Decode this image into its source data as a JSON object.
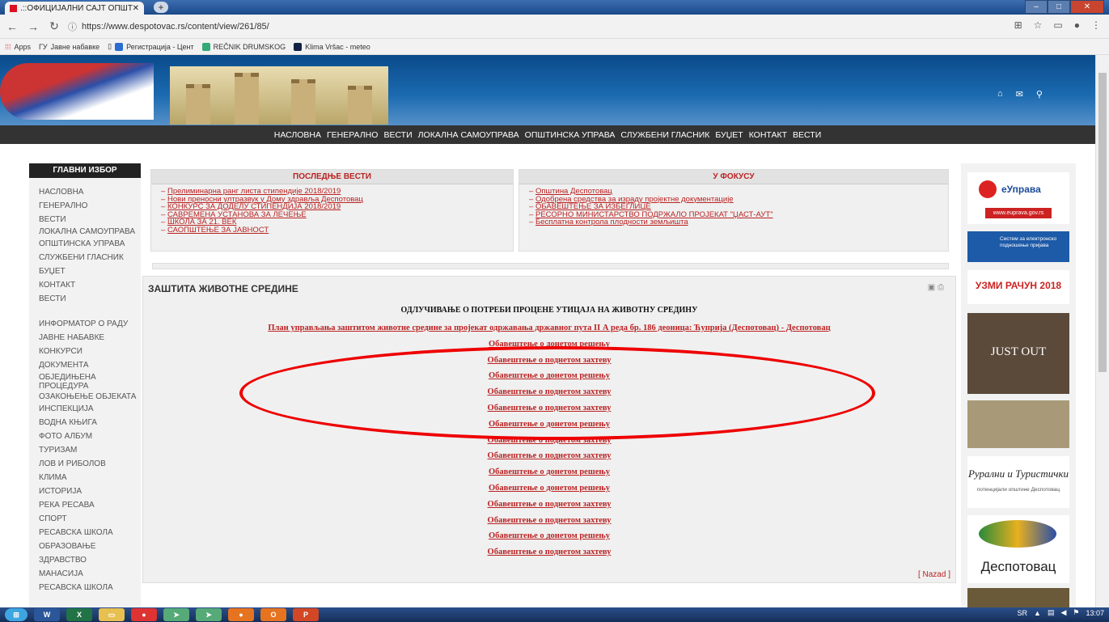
{
  "browser": {
    "tab_title": ".::ОФИЦИЈАЛНИ САЈТ ОПШТИ",
    "url": "https://www.despotovac.rs/content/view/261/85/",
    "bookmarks": [
      "Apps",
      "Јавне набавке",
      "Регистрација - Цент",
      "REČNIK DRUMSKOG",
      "Klima Vršac - meteo"
    ]
  },
  "nav": [
    "НАСЛОВНА",
    "ГЕНЕРАЛНО",
    "ВЕСТИ",
    "ЛОКАЛНА САМОУПРАВА",
    "ОПШТИНСКА УПРАВА",
    "СЛУЖБЕНИ ГЛАСНИК",
    "БУЏЕТ",
    "КОНТАКТ",
    "ВЕСТИ"
  ],
  "left_menu": {
    "title": "ГЛАВНИ ИЗБОР",
    "items": [
      "НАСЛОВНА",
      "ГЕНЕРАЛНО",
      "ВЕСТИ",
      "ЛОКАЛНА САМОУПРАВА",
      "ОПШТИНСКА УПРАВА",
      "СЛУЖБЕНИ ГЛАСНИК",
      "БУЏЕТ",
      "КОНТАКТ",
      "ВЕСТИ",
      "",
      "ИНФОРМАТОР О РАДУ",
      "ЈАВНЕ НАБАВКЕ",
      "КОНКУРСИ",
      "ДОКУМЕНТА",
      "ОБЈЕДИЊЕНА ПРОЦЕДУРА",
      "ОЗАКОЊЕЊЕ ОБЈЕКАТА",
      "ИНСПЕКЦИЈА",
      "ВОДНА КЊИГА",
      "ФОТО АЛБУМ",
      "ТУРИЗАМ",
      "ЛОВ И РИБОЛОВ",
      "КЛИМА",
      "ИСТОРИЈА",
      "РЕКА РЕСАВА",
      "СПОРТ",
      "РЕСАВСКА ШКОЛА",
      "ОБРАЗОВАЊЕ",
      "ЗДРАВСТВО",
      "МАНАСИЈА",
      "РЕСАВСКА ШКОЛА"
    ]
  },
  "latest_news": {
    "title": "ПОСЛЕДЊЕ ВЕСТИ",
    "items": [
      "Прелиминарна ранг листа стипендије 2018/2019",
      "Нови преносни ултразвук у Дому здравља Деспотовац",
      "КОНКУРС ЗА ДОДЕЛУ СТИПЕНДИЈА 2018/2019",
      "САВРЕМЕНА УСТАНОВА ЗА ЛЕЧЕЊЕ",
      "ШКОЛА ЗА 21. ВЕК",
      "САОПШТЕЊЕ ЗА ЈАВНОСТ"
    ]
  },
  "focus": {
    "title": "У ФОКУСУ",
    "items": [
      "Општина Деспотовац",
      "Одобрена средства за израду пројектне документације",
      "ОБАВЕШТЕЊЕ ЗА ИЗБЕГЛИЦЕ",
      "РЕСОРНО МИНИСТАРСТВО ПОДРЖАЛО ПРОЈЕКАТ \"ЏАСТ-АУТ\"",
      "Бесплатна контрола плодности земљишта"
    ]
  },
  "article": {
    "title": "ЗАШТИТА ЖИВОТНЕ СРЕДИНЕ",
    "subtitle": "ОДЛУЧИВАЊЕ О ПОТРЕБИ ПРОЦЕНЕ УТИЦАЈА НА ЖИВОТНУ СРЕДИНУ",
    "links": [
      "План управљања заштитом животне средине за пројекат одржавања државног пута II А реда бр. 186 деоница: Ћуприја (Деспотовац) - Деспотовац",
      "Обавештење о донетом решењу",
      "Обавештење о поднетом захтеву",
      "Обавештење о донетом решењу",
      "Обавештење о поднетом захтеву",
      "Обавештење о поднетом захтеву",
      "Обавештење о донетом решењу",
      "Обавештење о поднетом захтеву",
      "Обавештење о поднетом захтеву",
      "Обавештење о донетом решењу",
      "Обавештење о донетом решењу",
      "Обавештење о поднетом захтеву",
      "Обавештење о поднетом захтеву",
      "Обавештење о донетом решењу",
      "Обавештење о поднетом захтеву"
    ],
    "back": "[ Nazad ]"
  },
  "banners": [
    "еУправа",
    "www.euprava.gov.rs",
    "Систем за електронско подношење пријава",
    "УЗМИ РАЧУН 2018",
    "JUST OUT",
    "Рурални и Туристички",
    "потенцијали општине Деспотовац",
    "Деспотовац"
  ],
  "taskbar": {
    "lang": "SR",
    "time": "13:07"
  }
}
